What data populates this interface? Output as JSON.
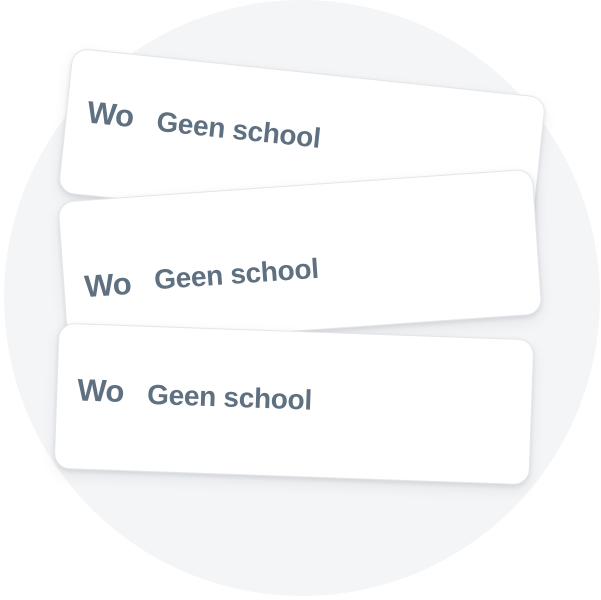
{
  "cards": [
    {
      "abbreviation": "Wo",
      "label": "Geen school"
    },
    {
      "abbreviation": "Wo",
      "label": "Geen school"
    },
    {
      "abbreviation": "Wo",
      "label": "Geen school"
    }
  ]
}
